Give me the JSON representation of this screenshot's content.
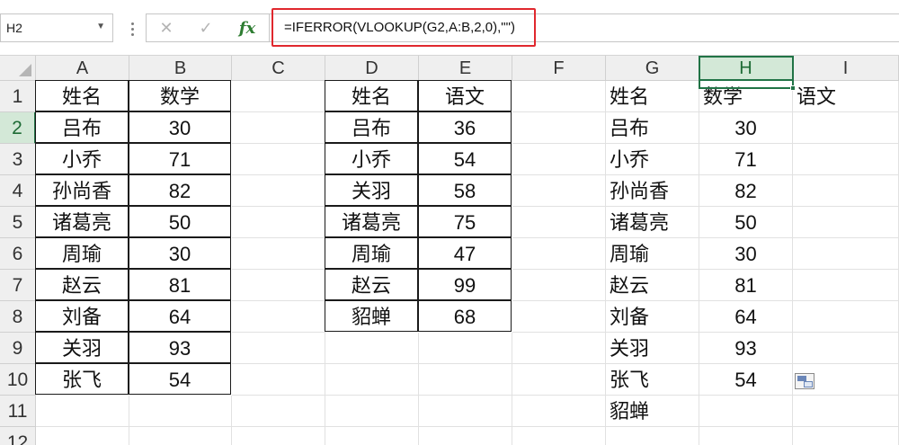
{
  "formula_bar": {
    "name_box": "H2",
    "formula": "=IFERROR(VLOOKUP(G2,A:B,2,0),\"\")",
    "fx_label": "fx",
    "cancel_glyph": "✕",
    "enter_glyph": "✓"
  },
  "selected": {
    "cell": "H2",
    "column": "H",
    "row": 2
  },
  "columns": [
    "A",
    "B",
    "C",
    "D",
    "E",
    "F",
    "G",
    "H",
    "I"
  ],
  "rows": [
    1,
    2,
    3,
    4,
    5,
    6,
    7,
    8,
    9,
    10,
    11,
    12
  ],
  "tables": {
    "table1": {
      "headers": [
        "姓名",
        "数学"
      ],
      "rows": [
        [
          "吕布",
          "30"
        ],
        [
          "小乔",
          "71"
        ],
        [
          "孙尚香",
          "82"
        ],
        [
          "诸葛亮",
          "50"
        ],
        [
          "周瑜",
          "30"
        ],
        [
          "赵云",
          "81"
        ],
        [
          "刘备",
          "64"
        ],
        [
          "关羽",
          "93"
        ],
        [
          "张飞",
          "54"
        ]
      ]
    },
    "table2": {
      "headers": [
        "姓名",
        "语文"
      ],
      "rows": [
        [
          "吕布",
          "36"
        ],
        [
          "小乔",
          "54"
        ],
        [
          "关羽",
          "58"
        ],
        [
          "诸葛亮",
          "75"
        ],
        [
          "周瑜",
          "47"
        ],
        [
          "赵云",
          "99"
        ],
        [
          "貂蝉",
          "68"
        ]
      ]
    },
    "table3": {
      "headers": [
        "姓名",
        "数学",
        "语文"
      ],
      "rows": [
        [
          "吕布",
          "30",
          ""
        ],
        [
          "小乔",
          "71",
          ""
        ],
        [
          "孙尚香",
          "82",
          ""
        ],
        [
          "诸葛亮",
          "50",
          ""
        ],
        [
          "周瑜",
          "30",
          ""
        ],
        [
          "赵云",
          "81",
          ""
        ],
        [
          "刘备",
          "64",
          ""
        ],
        [
          "关羽",
          "93",
          ""
        ],
        [
          "张飞",
          "54",
          ""
        ],
        [
          "貂蝉",
          "",
          ""
        ]
      ]
    }
  },
  "colors": {
    "selection": "#217346",
    "formula_highlight": "#e0282e",
    "fx": "#2e7d32"
  },
  "icons": [
    "cancel-icon",
    "enter-icon",
    "fx-icon",
    "paste-options-icon"
  ]
}
